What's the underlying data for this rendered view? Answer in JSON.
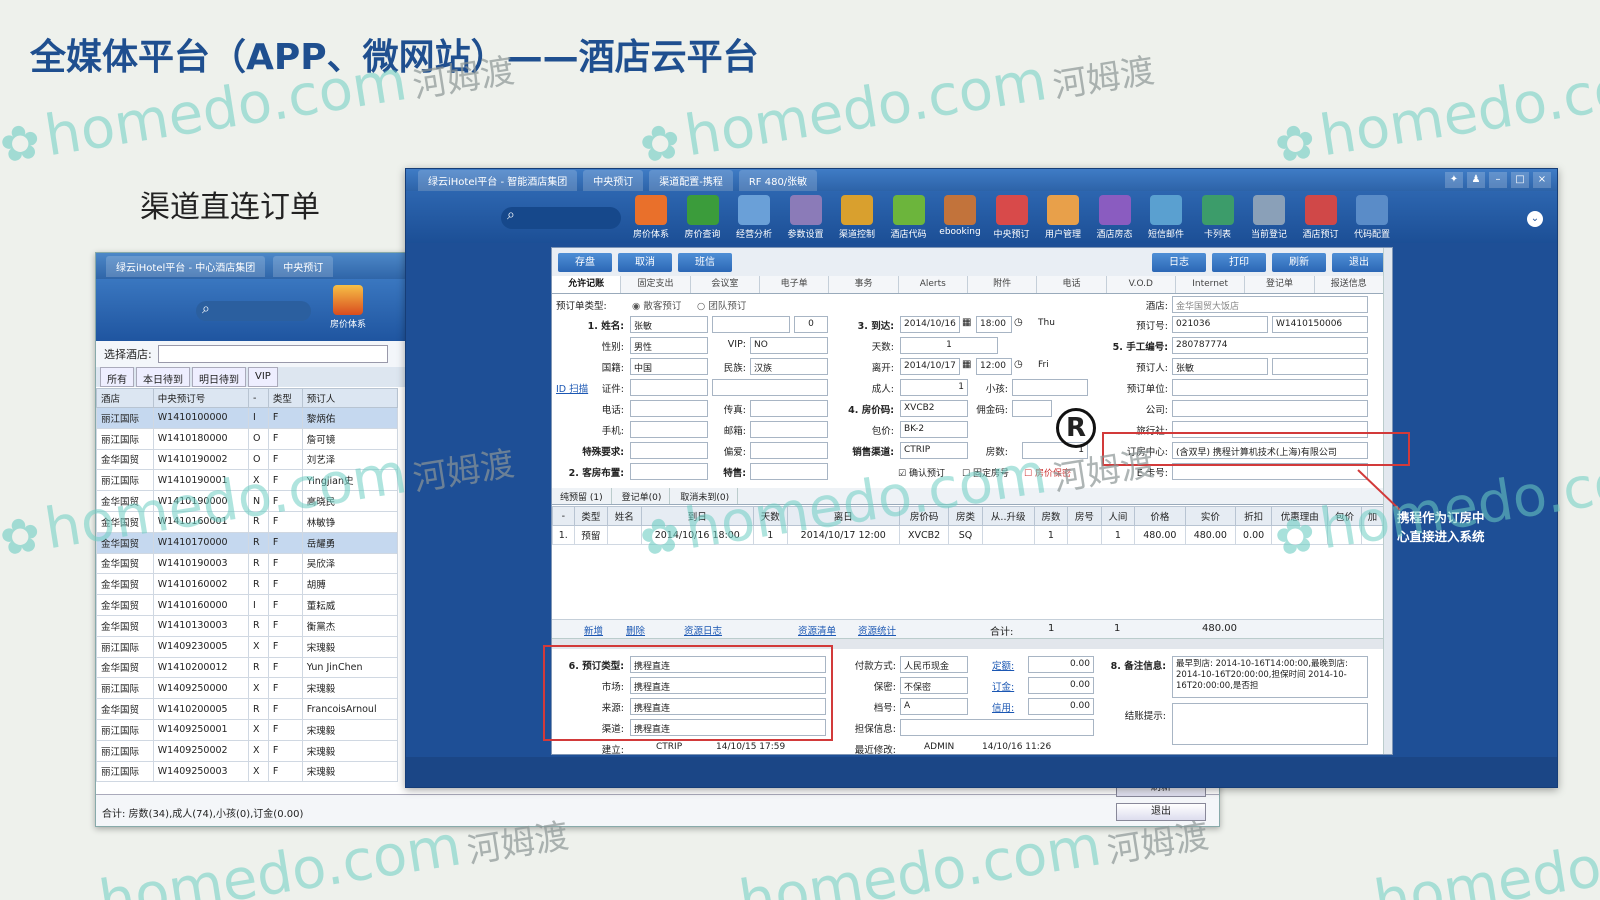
{
  "slide": {
    "title": "全媒体平台（APP、微网站）——酒店云平台",
    "subtitle": "渠道直连订单",
    "annotation": "携程作为订房中心直接进入系统"
  },
  "watermark": {
    "text": "homedo.com",
    "cn": "河姆渡"
  },
  "back_window": {
    "tabs": [
      "绿云iHotel平台 - 中心酒店集团",
      "中央预订"
    ],
    "toolbar": [
      {
        "icon": "house-price-icon",
        "label": "房价体系"
      }
    ],
    "select_hotel_label": "选择酒店:",
    "filter_tabs": [
      "所有",
      "本日待到",
      "明日待到",
      "VIP"
    ],
    "columns": [
      "酒店",
      "中央预订号",
      "-",
      "类型",
      "预订人"
    ],
    "rows": [
      [
        "丽江国际",
        "W1410100000",
        "I",
        "F",
        "黎炳佑"
      ],
      [
        "丽江国际",
        "W1410180000",
        "O",
        "F",
        "詹可镜"
      ],
      [
        "金华国贸",
        "W1410190002",
        "O",
        "F",
        "刘艺泽"
      ],
      [
        "丽江国际",
        "W1410190001",
        "X",
        "F",
        "Yingjian史"
      ],
      [
        "金华国贸",
        "W1410190000",
        "N",
        "F",
        "高晓民"
      ],
      [
        "金华国贸",
        "W1410160001",
        "R",
        "F",
        "林敏铮"
      ],
      [
        "金华国贸",
        "W1410170000",
        "R",
        "F",
        "岳耀勇"
      ],
      [
        "金华国贸",
        "W1410190003",
        "R",
        "F",
        "吴欣泽"
      ],
      [
        "金华国贸",
        "W1410160002",
        "R",
        "F",
        "胡膊"
      ],
      [
        "金华国贸",
        "W1410160000",
        "I",
        "F",
        "董耘威"
      ],
      [
        "金华国贸",
        "W1410130003",
        "R",
        "F",
        "衡黨杰"
      ],
      [
        "丽江国际",
        "W1409230005",
        "X",
        "F",
        "宋瑰毅"
      ],
      [
        "金华国贸",
        "W1410200012",
        "R",
        "F",
        "Yun JinChen"
      ],
      [
        "丽江国际",
        "W1409250000",
        "X",
        "F",
        "宋瑰毅"
      ],
      [
        "金华国贸",
        "W1410200005",
        "R",
        "F",
        "FrancoisArnoul"
      ],
      [
        "丽江国际",
        "W1409250001",
        "X",
        "F",
        "宋瑰毅"
      ],
      [
        "丽江国际",
        "W1409250002",
        "X",
        "F",
        "宋瑰毅"
      ],
      [
        "丽江国际",
        "W1409250003",
        "X",
        "F",
        "宋瑰毅"
      ]
    ],
    "total": "合计: 房数(34),成人(74),小孩(0),订金(0.00)",
    "buttons": [
      "刷新",
      "退出"
    ]
  },
  "front_window": {
    "tabs": [
      "绿云iHotel平台 - 智能酒店集团",
      "中央预订",
      "渠道配置-携程",
      "RF 480/张敏"
    ],
    "toolbar": [
      {
        "icon": "house-price-icon",
        "label": "房价体系",
        "color": "#e9702b"
      },
      {
        "icon": "room-query-icon",
        "label": "房价查询",
        "color": "#3b9c3b"
      },
      {
        "icon": "analysis-icon",
        "label": "经营分析",
        "color": "#6aa0d8"
      },
      {
        "icon": "gear-icon",
        "label": "参数设置",
        "color": "#8b7bb8"
      },
      {
        "icon": "channel-icon",
        "label": "渠道控制",
        "color": "#d9a02e"
      },
      {
        "icon": "hotel-code-icon",
        "label": "酒店代码",
        "color": "#6cb53c"
      },
      {
        "icon": "ebooking-icon",
        "label": "ebooking",
        "color": "#c2733b"
      },
      {
        "icon": "crs-icon",
        "label": "中央预订",
        "color": "#d84a4a"
      },
      {
        "icon": "user-icon",
        "label": "用户管理",
        "color": "#e8a04a"
      },
      {
        "icon": "hotel-status-icon",
        "label": "酒店房态",
        "color": "#8a5cc0"
      },
      {
        "icon": "sms-icon",
        "label": "短信邮件",
        "color": "#5aa0d0"
      },
      {
        "icon": "card-icon",
        "label": "卡列表",
        "color": "#3c9c6a"
      },
      {
        "icon": "register-icon",
        "label": "当前登记",
        "color": "#8aa0b8"
      },
      {
        "icon": "booking-icon",
        "label": "酒店预订",
        "color": "#d04848"
      },
      {
        "icon": "code-icon",
        "label": "代码配置",
        "color": "#5a8cc8"
      }
    ],
    "action_buttons_left": [
      "存盘",
      "取消",
      "班信"
    ],
    "action_buttons_right": [
      "日志",
      "打印",
      "刷新",
      "退出"
    ],
    "form_tabs": [
      "允许记账",
      "固定支出",
      "会议室",
      "电子单",
      "事务",
      "Alerts",
      "附件",
      "电话",
      "V.O.D",
      "Internet",
      "登记单",
      "报送信息"
    ],
    "booking_type": {
      "label": "预订单类型:",
      "options": [
        "散客预订",
        "团队预订"
      ]
    },
    "fields": {
      "name_label": "1. 姓名:",
      "name": "张敏",
      "name_extra": "0",
      "gender_label": "性别:",
      "gender": "男性",
      "vip_label": "VIP:",
      "vip": "NO",
      "country_label": "国籍:",
      "country": "中国",
      "ethnic_label": "民族:",
      "ethnic": "汉族",
      "id_link": "ID 扫描",
      "id_label": "证件:",
      "phone_label": "电话:",
      "fax_label": "传真:",
      "mobile_label": "手机:",
      "mail_label": "邮箱:",
      "special_label": "特殊要求:",
      "pref_label": "偏爱:",
      "layout_label": "2. 客房布置:",
      "remark_label": "特售:",
      "arrival_label": "3. 到达:",
      "arrival_date": "2014/10/16",
      "arrival_time": "18:00",
      "arrival_day": "Thu",
      "nights_label": "天数:",
      "nights": "1",
      "depart_label": "离开:",
      "depart_date": "2014/10/17",
      "depart_time": "12:00",
      "depart_day": "Fri",
      "adults_label": "成人:",
      "adults": "1",
      "children_label": "小孩:",
      "ratecode_label": "4. 房价码:",
      "ratecode": "XVCB2",
      "commission_label": "佣金码:",
      "package_label": "包价:",
      "package": "BK-2",
      "sales_label": "销售渠道:",
      "sales": "CTRIP",
      "rooms_label": "房数:",
      "rooms": "1",
      "check_confirm": "确认预订",
      "check_fixed": "固定房号",
      "check_secret": "房价保密",
      "hotel_label": "酒店:",
      "hotel": "金华国贸大饭店",
      "booking_no_label": "预订号:",
      "booking_no": "021036",
      "booking_no2": "W1410150006",
      "manual_no_label": "5. 手工编号:",
      "manual_no": "280787774",
      "booker_label": "预订人:",
      "booker": "张敏",
      "booking_unit_label": "预订单位:",
      "company_label": "公司:",
      "travel_label": "旅行社:",
      "center_label": "订房中心:",
      "center": "(含双早) 携程计算机技术(上海)有限公司",
      "ecard_label": "E 卡号:"
    },
    "res_tabs": [
      "纯预留 (1)",
      "登记单(0)",
      "取消未到(0)"
    ],
    "res_columns": [
      "-",
      "类型",
      "姓名",
      "到日",
      "天数",
      "离日",
      "房价码",
      "房类",
      "从..升级",
      "房数",
      "房号",
      "人间",
      "价格",
      "实价",
      "折扣",
      "优惠理由",
      "包价",
      "加"
    ],
    "res_row": [
      "1.",
      "预留",
      "",
      "2014/10/16 18:00",
      "1",
      "2014/10/17 12:00",
      "XVCB2",
      "SQ",
      "",
      "1",
      "",
      "1",
      "480.00",
      "480.00",
      "0.00",
      "",
      "",
      ""
    ],
    "res_actions": [
      "新增",
      "删除",
      "资源日志",
      "资源清单",
      "资源统计"
    ],
    "res_total": {
      "label": "合计:",
      "rooms": "1",
      "people": "1",
      "amount": "480.00"
    },
    "bottom": {
      "type_label": "6. 预订类型:",
      "type": "携程直连",
      "market_label": "市场:",
      "market": "携程直连",
      "source_label": "来源:",
      "source": "携程直连",
      "channel_label": "渠道:",
      "channel": "携程直连",
      "created_label": "建立:",
      "created_user": "CTRIP",
      "created_time": "14/10/15 17:59",
      "pay_label": "付款方式:",
      "pay": "人民币现金",
      "deposit_link": "定额:",
      "deposit": "0.00",
      "guarantee_label": "保密:",
      "guarantee": "不保密",
      "order_link": "订金:",
      "order": "0.00",
      "grade_label": "档号:",
      "grade": "A",
      "credit_link": "信用:",
      "credit": "0.00",
      "guar_info_label": "担保信息:",
      "modified_label": "最近修改:",
      "modified_user": "ADMIN",
      "modified_time": "14/10/16 11:26",
      "note_label": "8. 备注信息:",
      "note": "最早到店: 2014-10-16T14:00:00,最晚到店: 2014-10-16T20:00:00,担保时间 2014-10-16T20:00:00,是否担",
      "checkout_label": "结账提示:"
    }
  }
}
